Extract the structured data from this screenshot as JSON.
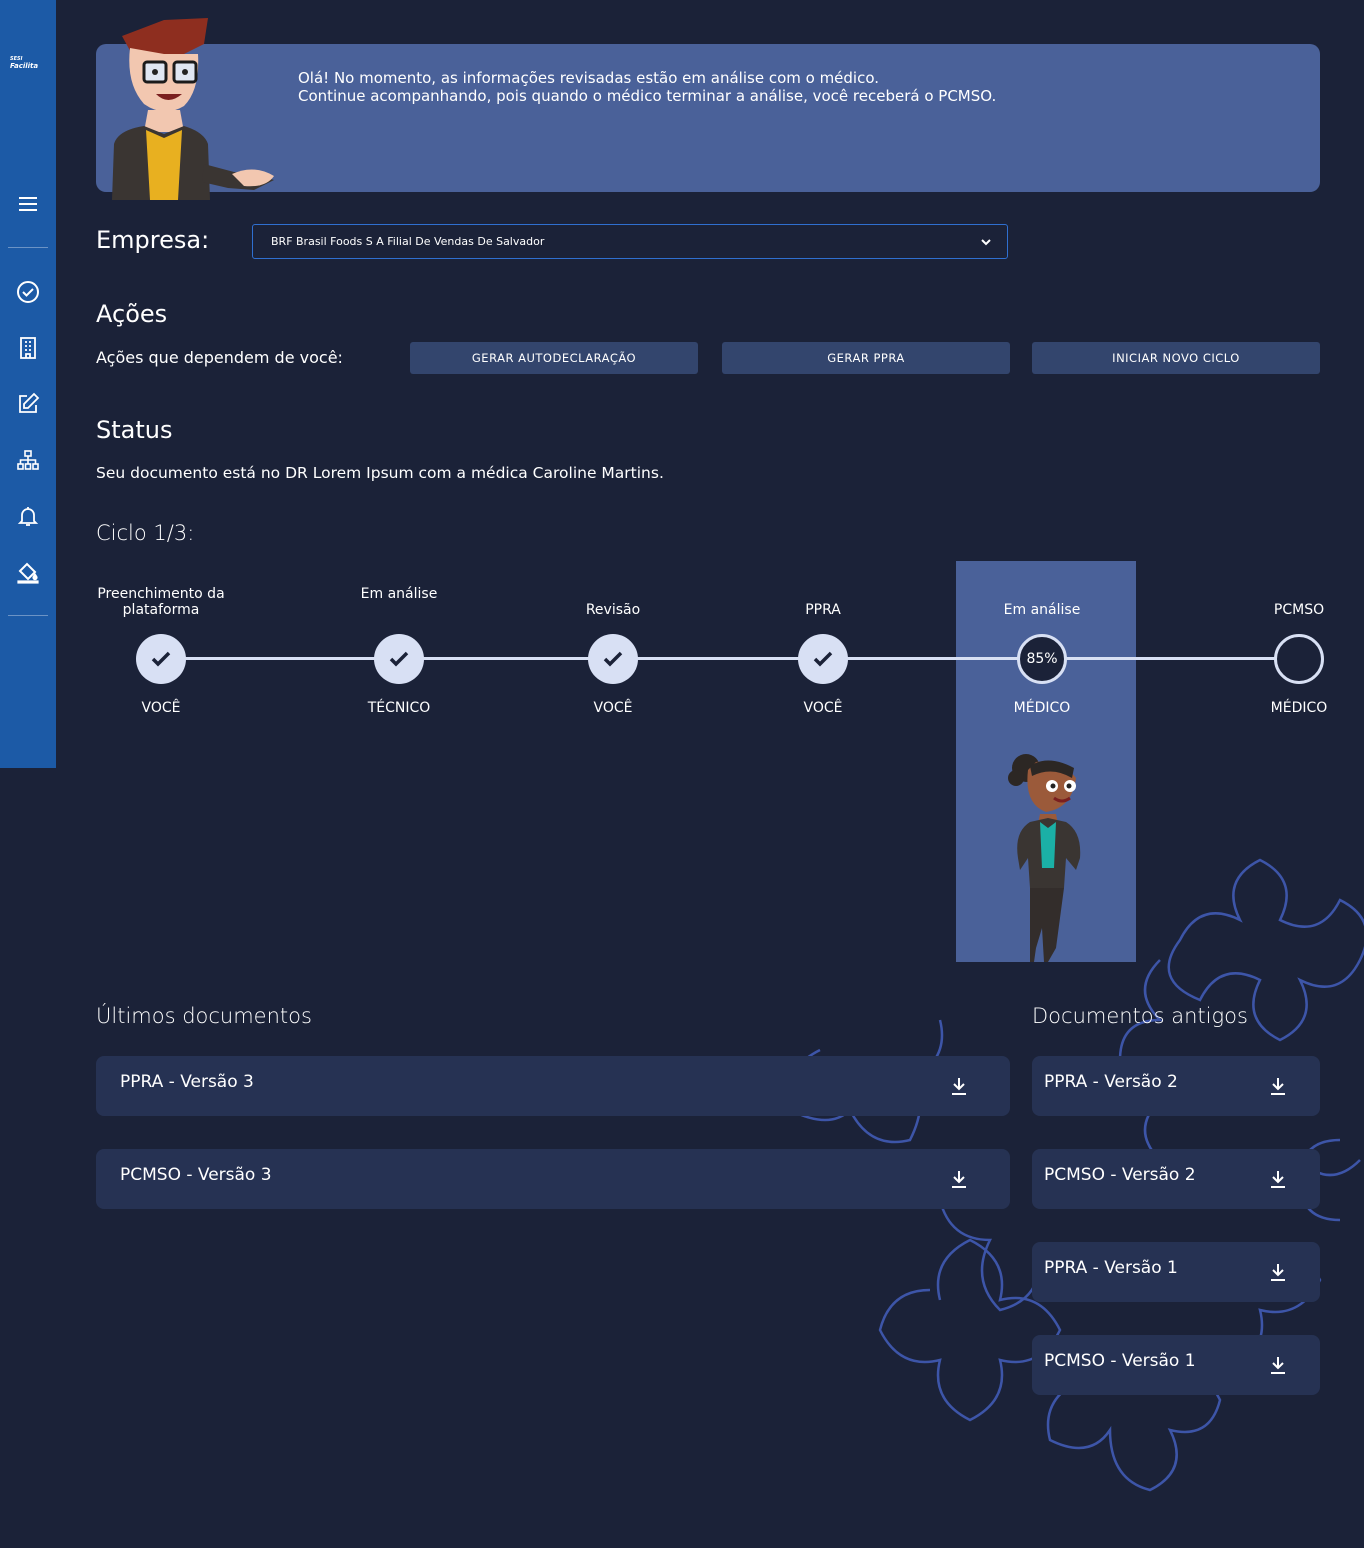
{
  "sidebar": {
    "logo_line1": "SESI",
    "logo_line2": "Facilita",
    "icons": [
      "menu-icon",
      "check-circle-icon",
      "building-icon",
      "edit-icon",
      "org-chart-icon",
      "bell-icon",
      "paint-bucket-icon"
    ]
  },
  "banner": {
    "line1": "Olá! No momento, as informações revisadas estão em análise com o médico.",
    "line2": "Continue acompanhando, pois quando o médico terminar a análise, você receberá o PCMSO."
  },
  "empresa": {
    "label": "Empresa:",
    "selected": "BRF Brasil Foods S A Filial De Vendas De Salvador"
  },
  "acoes": {
    "title": "Ações",
    "subtitle": "Ações que dependem de você:",
    "buttons": [
      "GERAR AUTODECLARAÇÃO",
      "GERAR PPRA",
      "INICIAR NOVO CICLO"
    ]
  },
  "status": {
    "title": "Status",
    "text": "Seu documento está no DR Lorem Ipsum com a médica Caroline Martins.",
    "ciclo": "Ciclo 1/3:"
  },
  "steps": [
    {
      "top": "Preenchimento da plataforma",
      "bottom": "VOCÊ",
      "state": "done"
    },
    {
      "top": "Em análise",
      "bottom": "TÉCNICO",
      "state": "done"
    },
    {
      "top": "Revisão",
      "bottom": "VOCÊ",
      "state": "done"
    },
    {
      "top": "PPRA",
      "bottom": "VOCÊ",
      "state": "done"
    },
    {
      "top": "Em análise",
      "bottom": "MÉDICO",
      "state": "active",
      "progress": "85%"
    },
    {
      "top": "PCMSO",
      "bottom": "MÉDICO",
      "state": "todo"
    }
  ],
  "ultimos": {
    "title": "Últimos documentos",
    "items": [
      "PPRA - Versão 3",
      "PCMSO - Versão 3"
    ]
  },
  "antigos": {
    "title": "Documentos antigos",
    "items": [
      "PPRA - Versão 2",
      "PCMSO - Versão 2",
      "PPRA - Versão 1",
      "PCMSO - Versão 1"
    ]
  },
  "colors": {
    "background": "#1b2238",
    "sidebar": "#1c5aa6",
    "banner": "#4a6199",
    "button": "#33456d",
    "card": "#263253",
    "accent": "#d8e0f4"
  }
}
